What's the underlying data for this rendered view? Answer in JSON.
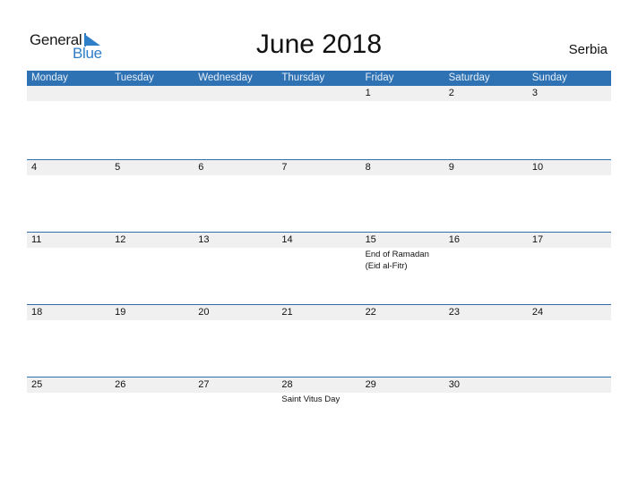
{
  "logo": {
    "general": "General",
    "blue": "Blue"
  },
  "title": "June 2018",
  "country": "Serbia",
  "colors": {
    "header_bg": "#2e72b4",
    "band_bg": "#f0f0f0",
    "brand_blue": "#2f7ec8"
  },
  "weekdays": [
    "Monday",
    "Tuesday",
    "Wednesday",
    "Thursday",
    "Friday",
    "Saturday",
    "Sunday"
  ],
  "weeks": [
    {
      "days": [
        {
          "num": ""
        },
        {
          "num": ""
        },
        {
          "num": ""
        },
        {
          "num": ""
        },
        {
          "num": "1"
        },
        {
          "num": "2"
        },
        {
          "num": "3"
        }
      ]
    },
    {
      "days": [
        {
          "num": "4"
        },
        {
          "num": "5"
        },
        {
          "num": "6"
        },
        {
          "num": "7"
        },
        {
          "num": "8"
        },
        {
          "num": "9"
        },
        {
          "num": "10"
        }
      ]
    },
    {
      "days": [
        {
          "num": "11"
        },
        {
          "num": "12"
        },
        {
          "num": "13"
        },
        {
          "num": "14"
        },
        {
          "num": "15",
          "holiday": "End of Ramadan\n(Eid al-Fitr)"
        },
        {
          "num": "16"
        },
        {
          "num": "17"
        }
      ]
    },
    {
      "days": [
        {
          "num": "18"
        },
        {
          "num": "19"
        },
        {
          "num": "20"
        },
        {
          "num": "21"
        },
        {
          "num": "22"
        },
        {
          "num": "23"
        },
        {
          "num": "24"
        }
      ]
    },
    {
      "days": [
        {
          "num": "25"
        },
        {
          "num": "26"
        },
        {
          "num": "27"
        },
        {
          "num": "28",
          "holiday": "Saint Vitus Day"
        },
        {
          "num": "29"
        },
        {
          "num": "30"
        },
        {
          "num": ""
        }
      ]
    }
  ]
}
